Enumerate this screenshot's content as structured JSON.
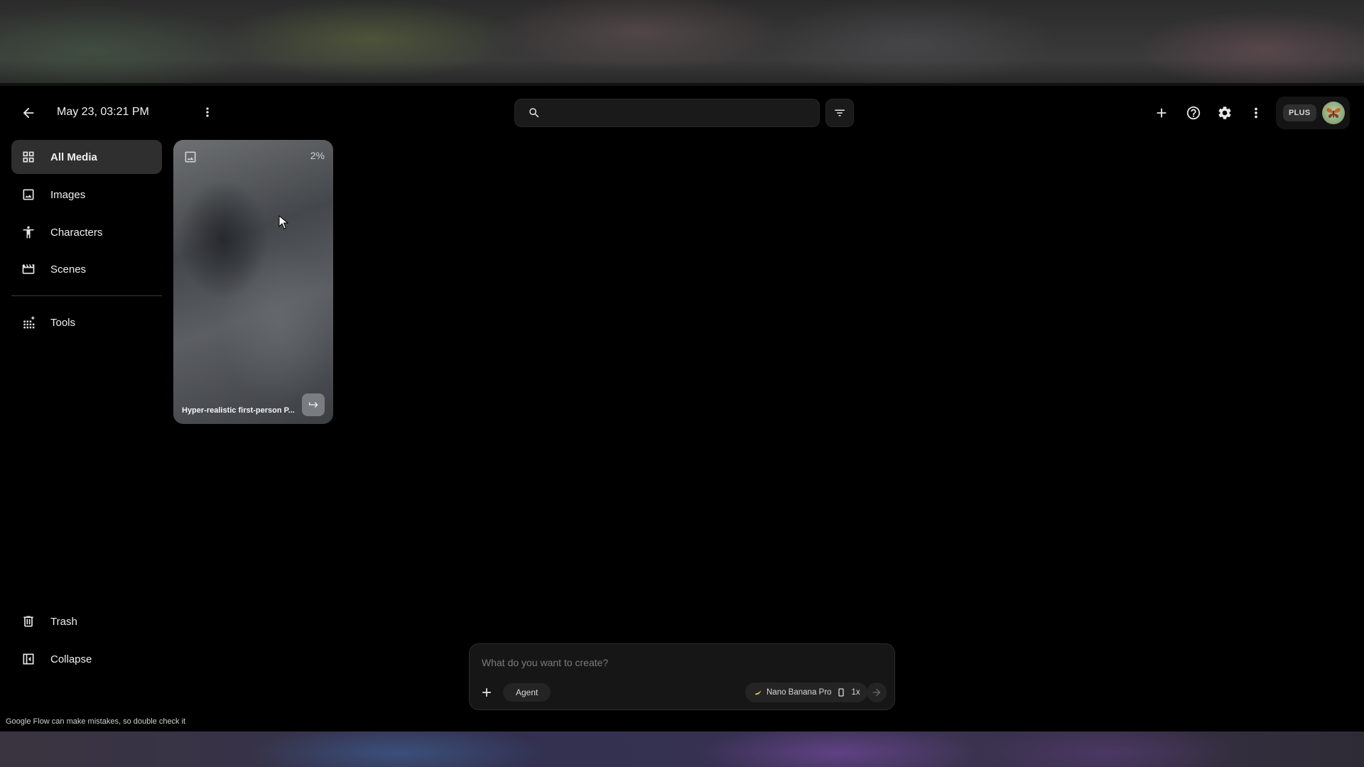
{
  "project": {
    "title": "May 23, 03:21 PM"
  },
  "search": {
    "placeholder": ""
  },
  "account": {
    "plan_badge": "PLUS"
  },
  "sidebar": {
    "items": [
      {
        "label": "All Media",
        "icon": "grid-icon",
        "active": true
      },
      {
        "label": "Images",
        "icon": "image-icon"
      },
      {
        "label": "Characters",
        "icon": "person-icon"
      },
      {
        "label": "Scenes",
        "icon": "clapperboard-icon"
      },
      {
        "label": "Tools",
        "icon": "tools-grid-icon"
      }
    ],
    "footer": [
      {
        "label": "Trash",
        "icon": "trash-icon"
      },
      {
        "label": "Collapse",
        "icon": "collapse-sidebar-icon"
      }
    ]
  },
  "media": [
    {
      "caption": "Hyper-realistic first-person P...",
      "progress": "2%",
      "type": "image"
    }
  ],
  "composer": {
    "placeholder": "What do you want to create?",
    "agent_label": "Agent",
    "model_label": "Nano Banana Pro",
    "count_label": "1x"
  },
  "footer": {
    "disclaimer": "Google Flow can make mistakes, so double check it"
  },
  "colors": {
    "background": "#000000",
    "active_nav": "#2f2f2f",
    "surface": "#161616"
  }
}
